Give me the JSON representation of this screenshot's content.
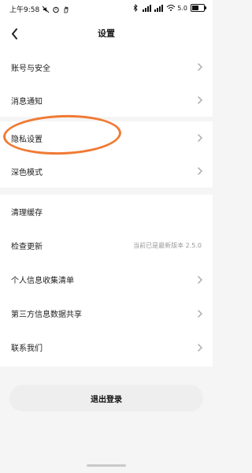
{
  "status_bar": {
    "time": "上午9:58",
    "network_speed": "5.0",
    "battery_level": 0.6
  },
  "header": {
    "title": "设置"
  },
  "settings": {
    "group1": [
      {
        "label": "账号与安全"
      },
      {
        "label": "消息通知"
      }
    ],
    "group2": [
      {
        "label": "隐私设置"
      },
      {
        "label": "深色模式"
      }
    ],
    "group3": [
      {
        "label": "清理缓存"
      },
      {
        "label": "检查更新",
        "value": "当前已是最新版本 2.5.0"
      },
      {
        "label": "个人信息收集清单"
      },
      {
        "label": "第三方信息数据共享"
      },
      {
        "label": "联系我们"
      }
    ]
  },
  "logout": {
    "label": "退出登录"
  },
  "colors": {
    "highlight": "#f07a34"
  },
  "icons": {
    "back": "chevron-left",
    "row": "chevron-right"
  }
}
